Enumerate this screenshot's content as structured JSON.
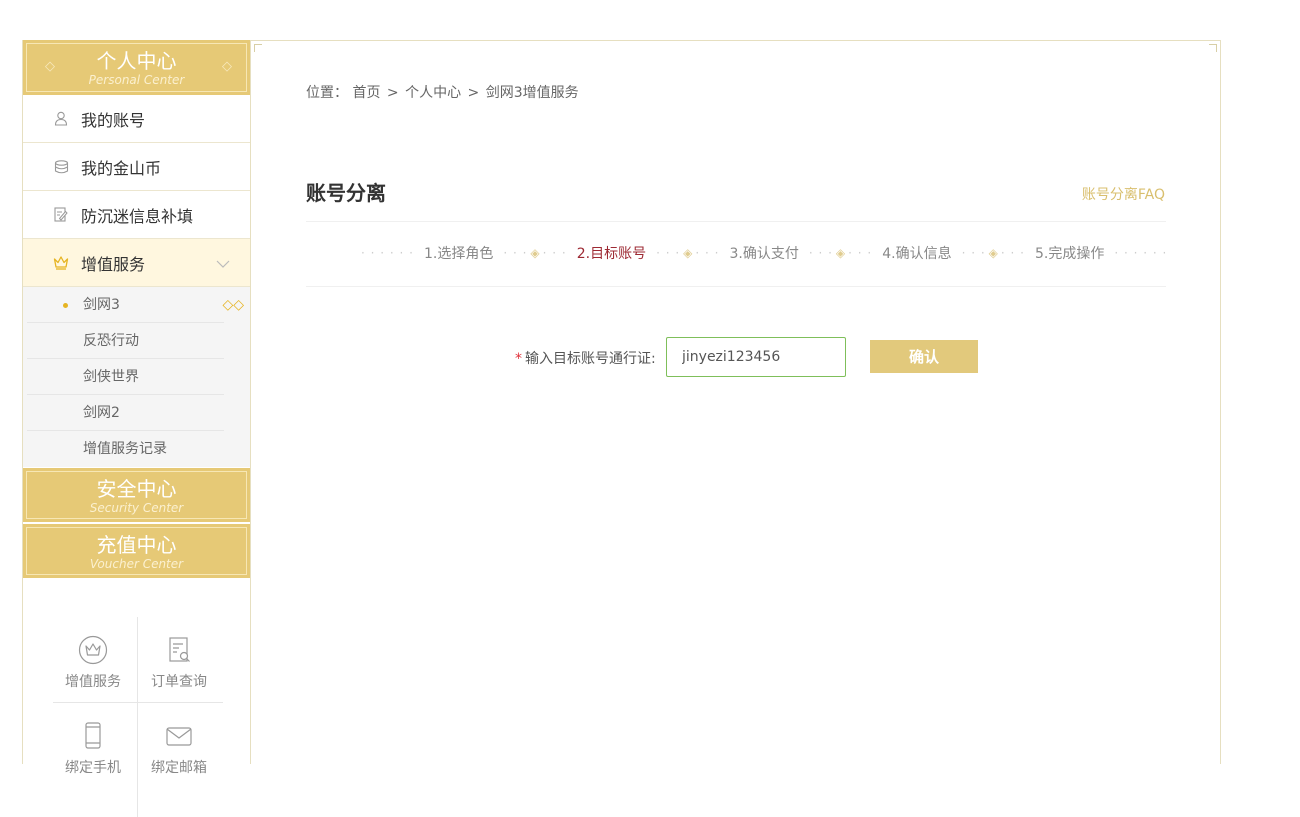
{
  "sidebar": {
    "personal": {
      "title_cn": "个人中心",
      "title_en": "Personal Center"
    },
    "menu": [
      {
        "label": "我的账号",
        "icon": "user-icon"
      },
      {
        "label": "我的金山币",
        "icon": "coins-icon"
      },
      {
        "label": "防沉迷信息补填",
        "icon": "edit-form-icon"
      },
      {
        "label": "增值服务",
        "icon": "crown-icon",
        "active": true
      }
    ],
    "submenu": [
      {
        "label": "剑网3",
        "active": true
      },
      {
        "label": "反恐行动"
      },
      {
        "label": "剑侠世界"
      },
      {
        "label": "剑网2"
      },
      {
        "label": "增值服务记录"
      }
    ],
    "security": {
      "title_cn": "安全中心",
      "title_en": "Security Center"
    },
    "voucher": {
      "title_cn": "充值中心",
      "title_en": "Voucher Center"
    },
    "quick_links": [
      {
        "label": "增值服务",
        "icon": "crown-circle-icon"
      },
      {
        "label": "订单查询",
        "icon": "order-search-icon"
      },
      {
        "label": "绑定手机",
        "icon": "phone-icon"
      },
      {
        "label": "绑定邮箱",
        "icon": "mail-icon"
      }
    ]
  },
  "breadcrumb": {
    "prefix": "位置：",
    "items": [
      "首页",
      "个人中心",
      "剑网3增值服务"
    ],
    "separator": ">"
  },
  "main": {
    "title": "账号分离",
    "faq_link": "账号分离FAQ",
    "steps": [
      "1.选择角色",
      "2.目标账号",
      "3.确认支付",
      "4.确认信息",
      "5.完成操作"
    ],
    "current_step": 1,
    "form": {
      "required_mark": "*",
      "label": "输入目标账号通行证:",
      "value": "jinyezi123456",
      "submit_label": "确认"
    }
  },
  "colors": {
    "gold": "#e6c976",
    "active_step": "#9d2933",
    "input_border": "#7fbf5a"
  }
}
